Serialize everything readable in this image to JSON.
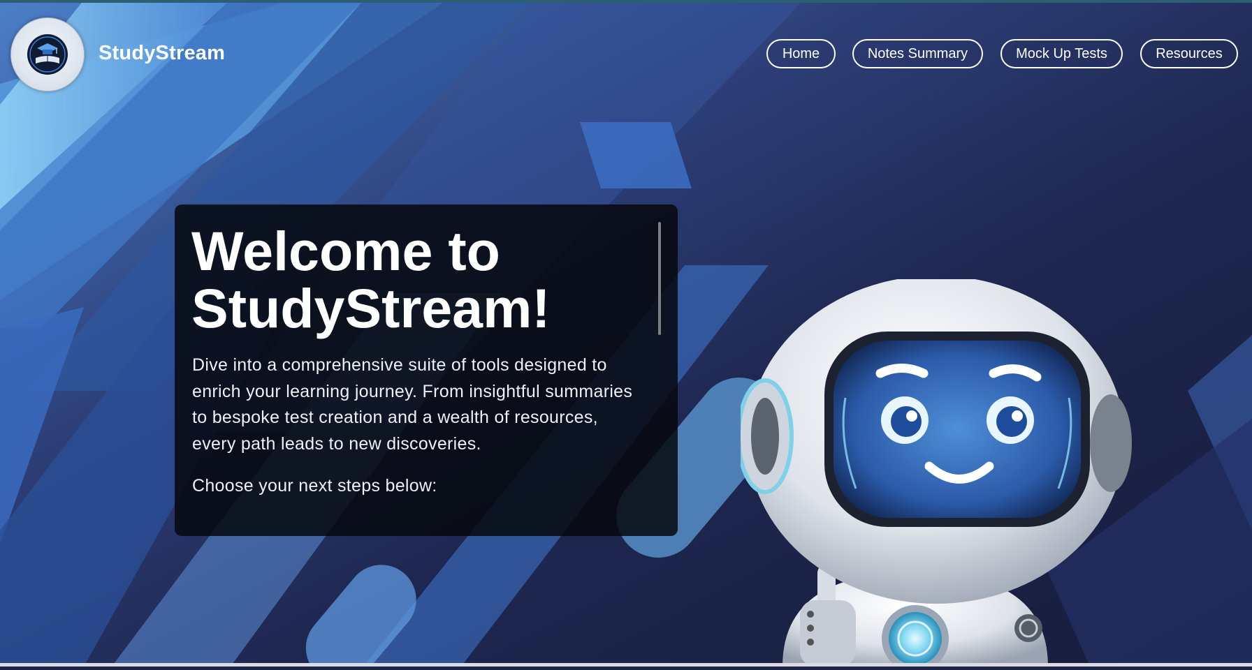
{
  "app": {
    "brand": "StudyStream"
  },
  "nav": {
    "items": [
      {
        "label": "Home"
      },
      {
        "label": "Notes Summary"
      },
      {
        "label": "Mock Up Tests"
      },
      {
        "label": "Resources"
      }
    ]
  },
  "hero": {
    "title": "Welcome to StudyStream!",
    "description": "Dive into a comprehensive suite of tools designed to enrich your learning journey. From insightful summaries to bespoke test creation and a wealth of resources, every path leads to new discoveries.",
    "next_steps": "Choose your next steps below:"
  },
  "colors": {
    "background_dark": "#1b2344",
    "accent_blue": "#4d8fe0",
    "card_bg": "rgba(6,8,14,0.86)",
    "text": "#ffffff"
  },
  "icons": {
    "logo": "book-graduation-cap-logo",
    "robot": "smiling-robot-illustration"
  }
}
